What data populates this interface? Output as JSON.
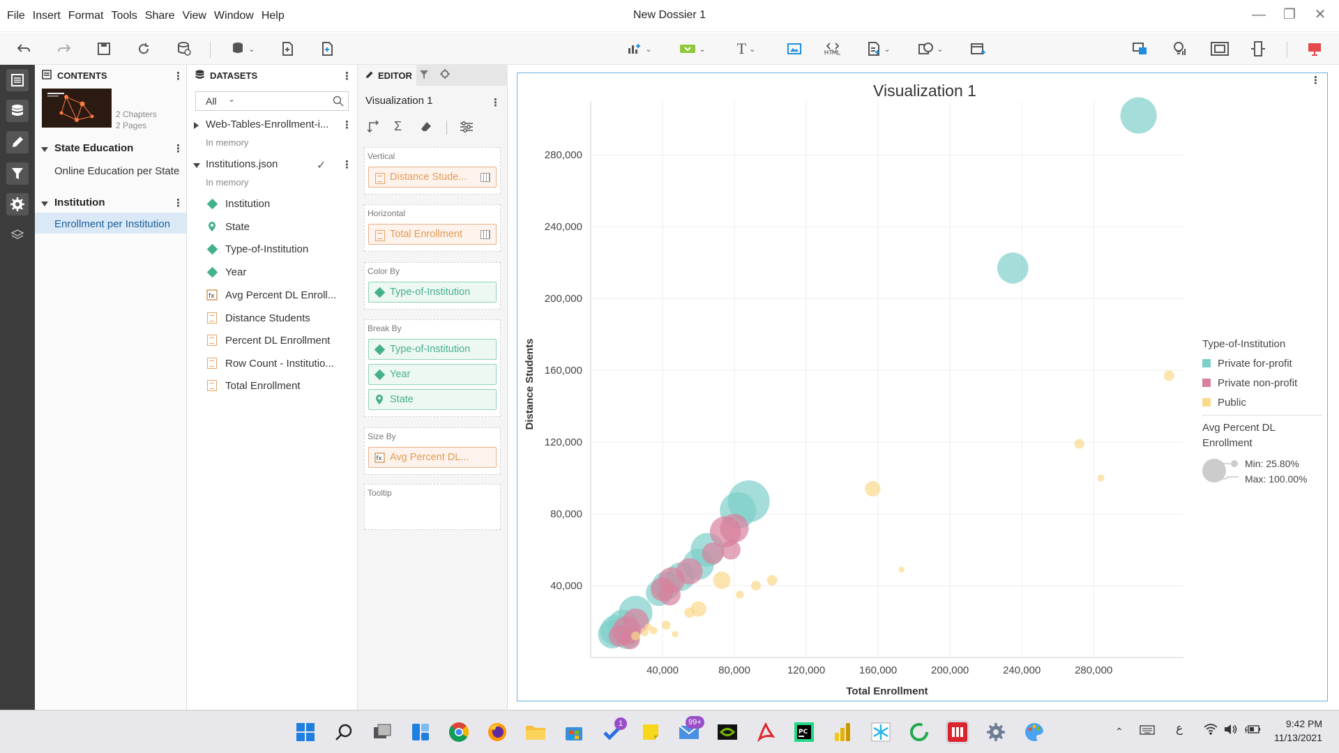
{
  "menu": [
    "File",
    "Insert",
    "Format",
    "Tools",
    "Share",
    "View",
    "Window",
    "Help"
  ],
  "document_title": "New Dossier 1",
  "contents": {
    "header": "CONTENTS",
    "summary_chapters": "2 Chapters",
    "summary_pages": "2 Pages",
    "chapters": [
      {
        "title": "State Education",
        "pages": [
          "Online Education per State"
        ]
      },
      {
        "title": "Institution",
        "pages": [
          "Enrollment per Institution"
        ]
      }
    ]
  },
  "datasets": {
    "header": "DATASETS",
    "filter_value": "All",
    "sets": [
      {
        "name": "Web-Tables-Enrollment-i...",
        "status": "In memory"
      },
      {
        "name": "Institutions.json",
        "status": "In memory"
      }
    ],
    "objects": [
      {
        "name": "Institution",
        "kind": "attribute",
        "icon": "attribute-diamond-icon"
      },
      {
        "name": "State",
        "kind": "geo",
        "icon": "geo-pin-icon"
      },
      {
        "name": "Type-of-Institution",
        "kind": "attribute",
        "icon": "attribute-diamond-icon"
      },
      {
        "name": "Year",
        "kind": "attribute",
        "icon": "attribute-diamond-icon"
      },
      {
        "name": "Avg Percent DL Enroll...",
        "kind": "derived",
        "icon": "fx-metric-icon"
      },
      {
        "name": "Distance Students",
        "kind": "metric",
        "icon": "metric-icon"
      },
      {
        "name": "Percent DL Enrollment",
        "kind": "metric",
        "icon": "metric-icon"
      },
      {
        "name": "Row Count - Institutio...",
        "kind": "metric",
        "icon": "metric-icon"
      },
      {
        "name": "Total Enrollment",
        "kind": "metric",
        "icon": "metric-icon"
      }
    ]
  },
  "editor": {
    "tab": "EDITOR",
    "viz_name": "Visualization 1",
    "zones": {
      "vertical": {
        "label": "Vertical",
        "items": [
          "Distance Stude..."
        ]
      },
      "horizontal": {
        "label": "Horizontal",
        "items": [
          "Total Enrollment"
        ]
      },
      "color_by": {
        "label": "Color By",
        "items": [
          "Type-of-Institution"
        ]
      },
      "break_by": {
        "label": "Break By",
        "items": [
          "Type-of-Institution",
          "Year",
          "State"
        ]
      },
      "size_by": {
        "label": "Size By",
        "items": [
          "Avg Percent DL..."
        ]
      },
      "tooltip": {
        "label": "Tooltip",
        "items": []
      }
    }
  },
  "colors": {
    "private_for_profit": "#7ecfc9",
    "private_non_profit": "#d9809c",
    "public": "#fbd98b",
    "accent": "#6aaee0"
  },
  "chart_data": {
    "type": "scatter",
    "title": "Visualization 1",
    "xlabel": "Total Enrollment",
    "ylabel": "Distance Students",
    "xlim": [
      0,
      330000
    ],
    "ylim": [
      0,
      310000
    ],
    "xticks": [
      40000,
      80000,
      120000,
      160000,
      200000,
      240000,
      280000
    ],
    "yticks": [
      40000,
      80000,
      120000,
      160000,
      200000,
      240000,
      280000
    ],
    "xtick_labels": [
      "40,000",
      "80,000",
      "120,000",
      "160,000",
      "200,000",
      "240,000",
      "280,000"
    ],
    "ytick_labels": [
      "40,000",
      "80,000",
      "120,000",
      "160,000",
      "200,000",
      "240,000",
      "280,000"
    ],
    "legend": {
      "color_title": "Type-of-Institution",
      "size_title_line1": "Avg Percent DL",
      "size_title_line2": "Enrollment",
      "size_min": "Min: 25.80%",
      "size_max": "Max: 100.00%",
      "position": "right"
    },
    "series": [
      {
        "name": "Private for-profit",
        "color": "#7ecfc9",
        "points": [
          [
            305000,
            302000,
            90
          ],
          [
            235000,
            217000,
            80
          ],
          [
            88000,
            87000,
            100
          ],
          [
            82000,
            82000,
            90
          ],
          [
            65000,
            60000,
            85
          ],
          [
            60000,
            52000,
            80
          ],
          [
            50000,
            45000,
            75
          ],
          [
            42000,
            40000,
            75
          ],
          [
            38000,
            36000,
            70
          ],
          [
            25000,
            25000,
            85
          ],
          [
            18000,
            18000,
            80
          ],
          [
            14000,
            15000,
            80
          ],
          [
            12000,
            13000,
            75
          ],
          [
            20000,
            12000,
            70
          ]
        ]
      },
      {
        "name": "Private non-profit",
        "color": "#d9809c",
        "points": [
          [
            75000,
            70000,
            80
          ],
          [
            80000,
            72000,
            75
          ],
          [
            78000,
            60000,
            55
          ],
          [
            68000,
            58000,
            60
          ],
          [
            55000,
            48000,
            70
          ],
          [
            45000,
            43000,
            70
          ],
          [
            44000,
            35000,
            60
          ],
          [
            40000,
            38000,
            65
          ],
          [
            25000,
            20000,
            70
          ],
          [
            20000,
            15000,
            75
          ],
          [
            16000,
            12000,
            60
          ],
          [
            22000,
            10000,
            55
          ]
        ]
      },
      {
        "name": "Public",
        "color": "#fbd98b",
        "points": [
          [
            322000,
            157000,
            30
          ],
          [
            272000,
            119000,
            28
          ],
          [
            284000,
            100000,
            18
          ],
          [
            157000,
            94000,
            45
          ],
          [
            173000,
            49000,
            12
          ],
          [
            73000,
            43000,
            50
          ],
          [
            92000,
            40000,
            28
          ],
          [
            101000,
            43000,
            30
          ],
          [
            83000,
            35000,
            22
          ],
          [
            60000,
            27000,
            45
          ],
          [
            55000,
            25000,
            30
          ],
          [
            42000,
            18000,
            25
          ],
          [
            30000,
            14000,
            22
          ],
          [
            25000,
            12000,
            25
          ],
          [
            35000,
            15000,
            20
          ],
          [
            47000,
            13000,
            15
          ],
          [
            32000,
            17000,
            18
          ]
        ]
      }
    ]
  },
  "taskbar": {
    "time": "9:42 PM",
    "date": "11/13/2021",
    "badge_todo": "1",
    "badge_mail": "99+",
    "lang": "ع"
  }
}
